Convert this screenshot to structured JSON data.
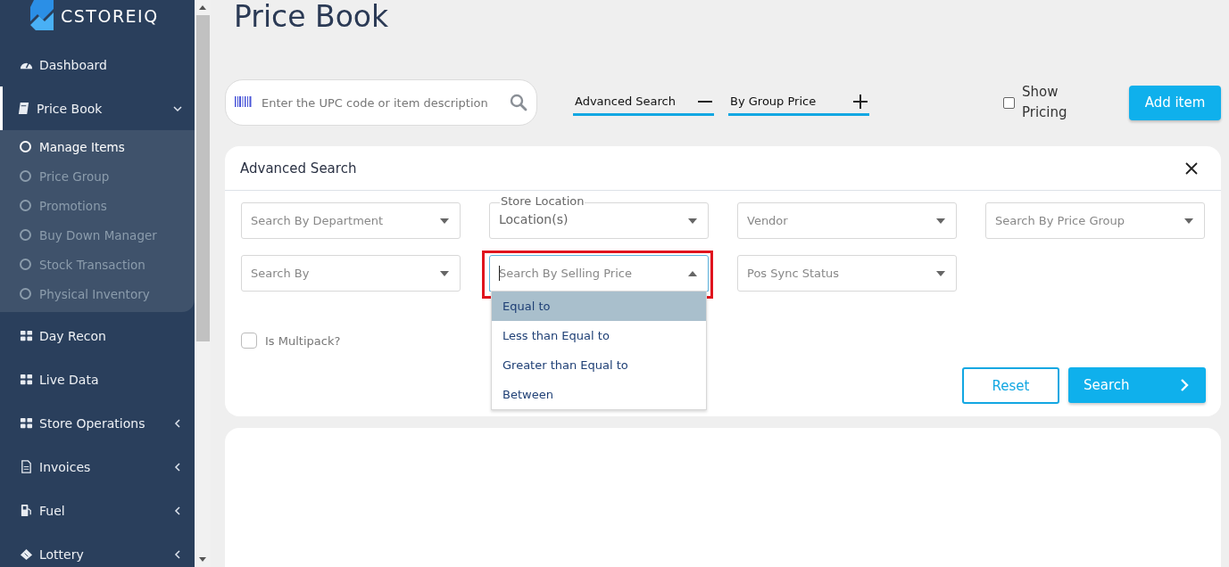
{
  "sidebar": {
    "logo": "CSTOREIQ",
    "items": [
      {
        "label": "Dashboard",
        "selected": false
      },
      {
        "label": "Price Book",
        "selected": true,
        "expanded": true,
        "children": [
          {
            "label": "Manage Items",
            "selected": true
          },
          {
            "label": "Price Group",
            "selected": false
          },
          {
            "label": "Promotions",
            "selected": false
          },
          {
            "label": "Buy Down Manager",
            "selected": false
          },
          {
            "label": "Stock Transaction",
            "selected": false
          },
          {
            "label": "Physical Inventory",
            "selected": false
          }
        ]
      },
      {
        "label": "Day Recon",
        "selected": false
      },
      {
        "label": "Live Data",
        "selected": false
      },
      {
        "label": "Store Operations",
        "selected": false,
        "expanded": false
      },
      {
        "label": "Invoices",
        "selected": false,
        "expanded": false
      },
      {
        "label": "Fuel",
        "selected": false,
        "expanded": false
      },
      {
        "label": "Lottery",
        "selected": false,
        "expanded": false
      }
    ]
  },
  "page_title": "Price Book",
  "search": {
    "placeholder": "Enter the UPC code or item description"
  },
  "toggles": [
    {
      "label": "Advanced Search",
      "expanded": true
    },
    {
      "label": "By Group Price",
      "expanded": false
    }
  ],
  "show_pricing": {
    "label": "Show Pricing",
    "checked": false
  },
  "add_button": "Add item",
  "advanced_search": {
    "title": "Advanced Search",
    "fields": [
      {
        "placeholder": "Search By Department"
      },
      {
        "label": "Store Location",
        "placeholder": "Location(s)"
      },
      {
        "placeholder": "Vendor"
      },
      {
        "placeholder": "Search By Price Group"
      },
      {
        "placeholder": "Search By"
      },
      {
        "placeholder": "Search By Selling Price",
        "focused": true,
        "annotated": true,
        "open": true,
        "options": [
          {
            "label": "Equal to",
            "selected": true
          },
          {
            "label": "Less than Equal to",
            "selected": false
          },
          {
            "label": "Greater than Equal to",
            "selected": false
          },
          {
            "label": "Between",
            "selected": false
          }
        ]
      },
      {
        "placeholder": "Pos Sync Status"
      }
    ],
    "multipack": {
      "label": "Is Multipack?",
      "checked": false
    },
    "buttons": [
      {
        "label": "Reset",
        "kind": "outline"
      },
      {
        "label": "Search",
        "kind": "primary"
      }
    ]
  }
}
